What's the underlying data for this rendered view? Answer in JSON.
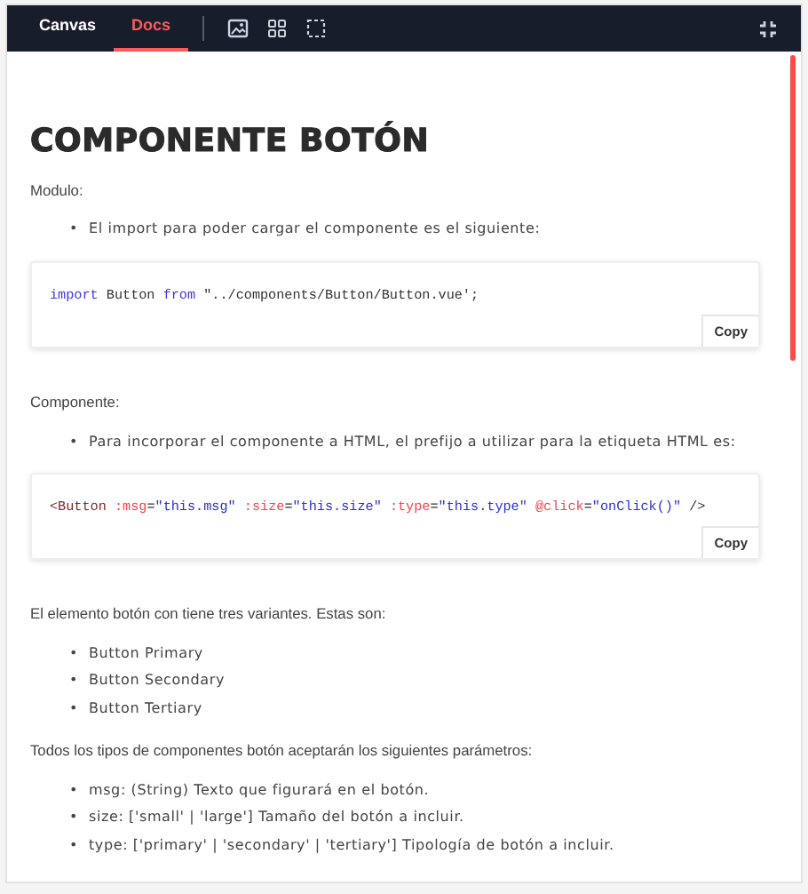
{
  "toolbar": {
    "tabs": [
      {
        "label": "Canvas",
        "selected": false
      },
      {
        "label": "Docs",
        "selected": true
      }
    ]
  },
  "doc": {
    "title": "COMPONENTE BOTÓN",
    "blocks": [
      {
        "kind": "paragraph",
        "text": "Modulo:"
      },
      {
        "kind": "list",
        "items": [
          {
            "marker": "•",
            "text": "El import para poder cargar el componente es el siguiente:"
          }
        ]
      },
      {
        "kind": "code",
        "button": "Copy",
        "tokens": [
          {
            "kind": "keyword",
            "text": "import"
          },
          {
            "kind": "plain",
            "text": " Button "
          },
          {
            "kind": "keyword",
            "text": "from"
          },
          {
            "kind": "plain",
            "text": " \"../components/Button/Button.vue';"
          }
        ]
      },
      {
        "kind": "paragraph",
        "text": "Componente:"
      },
      {
        "kind": "list",
        "items": [
          {
            "marker": "•",
            "text": "Para incorporar el componente a HTML, el prefijo a utilizar para la etiqueta HTML es:"
          }
        ]
      },
      {
        "kind": "code",
        "button": "Copy",
        "tokens": [
          {
            "kind": "tag",
            "text": "<Button"
          },
          {
            "kind": "attr",
            "text": " :msg"
          },
          {
            "kind": "plain",
            "text": "="
          },
          {
            "kind": "value",
            "text": "\"this.msg\""
          },
          {
            "kind": "attr",
            "text": " :size"
          },
          {
            "kind": "plain",
            "text": "="
          },
          {
            "kind": "value",
            "text": "\"this.size\""
          },
          {
            "kind": "attr",
            "text": " :type"
          },
          {
            "kind": "plain",
            "text": "="
          },
          {
            "kind": "value",
            "text": "\"this.type\""
          },
          {
            "kind": "attr",
            "text": " @click"
          },
          {
            "kind": "plain",
            "text": "="
          },
          {
            "kind": "value",
            "text": "\"onClick()\""
          },
          {
            "kind": "plain",
            "text": " />"
          }
        ]
      },
      {
        "kind": "paragraph",
        "text": "El elemento botón con tiene tres variantes. Estas son:"
      },
      {
        "kind": "list",
        "items": [
          {
            "marker": "•",
            "text": "Button Primary"
          },
          {
            "marker": "•",
            "text": "Button Secondary"
          },
          {
            "marker": "•",
            "text": "Button Tertiary"
          }
        ]
      },
      {
        "kind": "paragraph",
        "text": "Todos los tipos de componentes botón aceptarán los siguientes parámetros:"
      },
      {
        "kind": "list",
        "items": [
          {
            "marker": "•",
            "text": "msg: (String) Texto que figurará en el botón."
          },
          {
            "marker": "•",
            "text": "size: ['small' | 'large'] Tamaño del botón a incluir."
          },
          {
            "marker": "•",
            "text": "type: ['primary' | 'secondary' | 'tertiary'] Tipología de botón a incluir."
          }
        ]
      }
    ]
  }
}
